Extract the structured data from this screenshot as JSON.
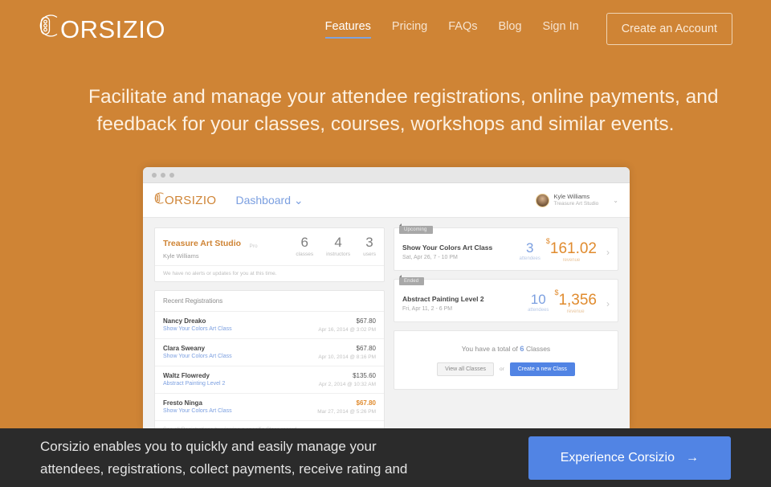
{
  "brand": {
    "logo_text": "ORSIZIO",
    "accent_orange": "#cf8435",
    "accent_blue": "#5184e4",
    "dark": "#2b2b2b"
  },
  "nav": {
    "items": [
      {
        "label": "Features",
        "active": true
      },
      {
        "label": "Pricing",
        "active": false
      },
      {
        "label": "FAQs",
        "active": false
      },
      {
        "label": "Blog",
        "active": false
      },
      {
        "label": "Sign In",
        "active": false
      }
    ],
    "cta_label": "Create an Account"
  },
  "hero": {
    "line1": "Facilitate and manage your attendee registrations, online payments, and",
    "line2": "feedback for your classes, courses, workshops and similar events."
  },
  "app": {
    "logo_text": "ORSIZIO",
    "nav_title": "Dashboard",
    "nav_caret": "⌄",
    "user": {
      "name": "Kyle Williams",
      "studio": "Treasure Art Studio",
      "caret": "⌄"
    },
    "studio_card": {
      "name": "Treasure Art Studio",
      "plan": "Pro",
      "owner": "Kyle Williams",
      "stats": [
        {
          "value": "6",
          "label": "classes"
        },
        {
          "value": "4",
          "label": "instructors"
        },
        {
          "value": "3",
          "label": "users"
        }
      ],
      "note": "We have no alerts or updates for you at this time."
    },
    "registrations": {
      "header": "Recent Registrations",
      "rows": [
        {
          "name": "Nancy Dreako",
          "class": "Show Your Colors Art Class",
          "amount": "$67.80",
          "date": "Apr 16, 2014 @ 3:02 PM",
          "highlight": false
        },
        {
          "name": "Clara Sweany",
          "class": "Show Your Colors Art Class",
          "amount": "$67.80",
          "date": "Apr 10, 2014 @ 8:16 PM",
          "highlight": false
        },
        {
          "name": "Waltz Flowredy",
          "class": "Abstract Painting Level 2",
          "amount": "$135.60",
          "date": "Apr 2, 2014 @ 10:32 AM",
          "highlight": false
        },
        {
          "name": "Fresto Ninga",
          "class": "Show Your Colors Art Class",
          "amount": "$67.80",
          "date": "Mar 27, 2014 @ 5:26 PM",
          "highlight": true
        }
      ],
      "footer": "See all Registrations by viewing a specific Class record."
    },
    "classes": [
      {
        "badge": "Upcoming",
        "title": "Show Your Colors Art Class",
        "date": "Sat, Apr 26, 7 - 10 PM",
        "attendees": "3",
        "attendees_label": "attendees",
        "currency": "$",
        "revenue": "161.02",
        "revenue_label": "revenue",
        "arrow": "›"
      },
      {
        "badge": "Ended",
        "title": "Abstract Painting Level 2",
        "date": "Fri, Apr 11, 2 - 6 PM",
        "attendees": "10",
        "attendees_label": "attendees",
        "currency": "$",
        "revenue": "1,356",
        "revenue_label": "revenue",
        "arrow": "›"
      }
    ],
    "totals": {
      "prefix": "You have a total of",
      "count": "6",
      "suffix": "Classes",
      "view_all_label": "View all Classes",
      "or_label": "or",
      "create_label": "Create a new Class"
    }
  },
  "band": {
    "line1": "Corsizio enables you to quickly and easily manage your",
    "line2": "attendees, registrations, collect payments, receive rating and",
    "button_label": "Experience Corsizio",
    "button_arrow": "→"
  }
}
